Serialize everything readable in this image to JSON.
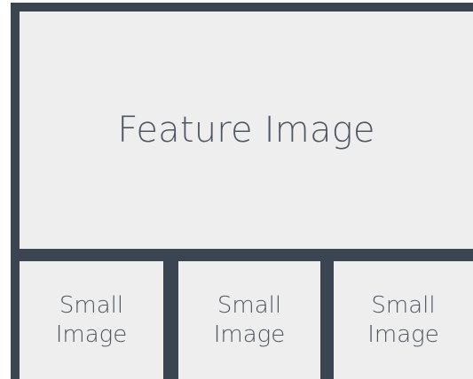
{
  "feature": {
    "label": "Feature Image"
  },
  "small_images": [
    {
      "line1": "Small",
      "line2": "Image"
    },
    {
      "line1": "Small",
      "line2": "Image"
    },
    {
      "line1": "Small",
      "line2": "Image"
    }
  ],
  "colors": {
    "frame": "#3b4552",
    "panel_bg": "#eeeeee",
    "text": "#4f5660"
  }
}
